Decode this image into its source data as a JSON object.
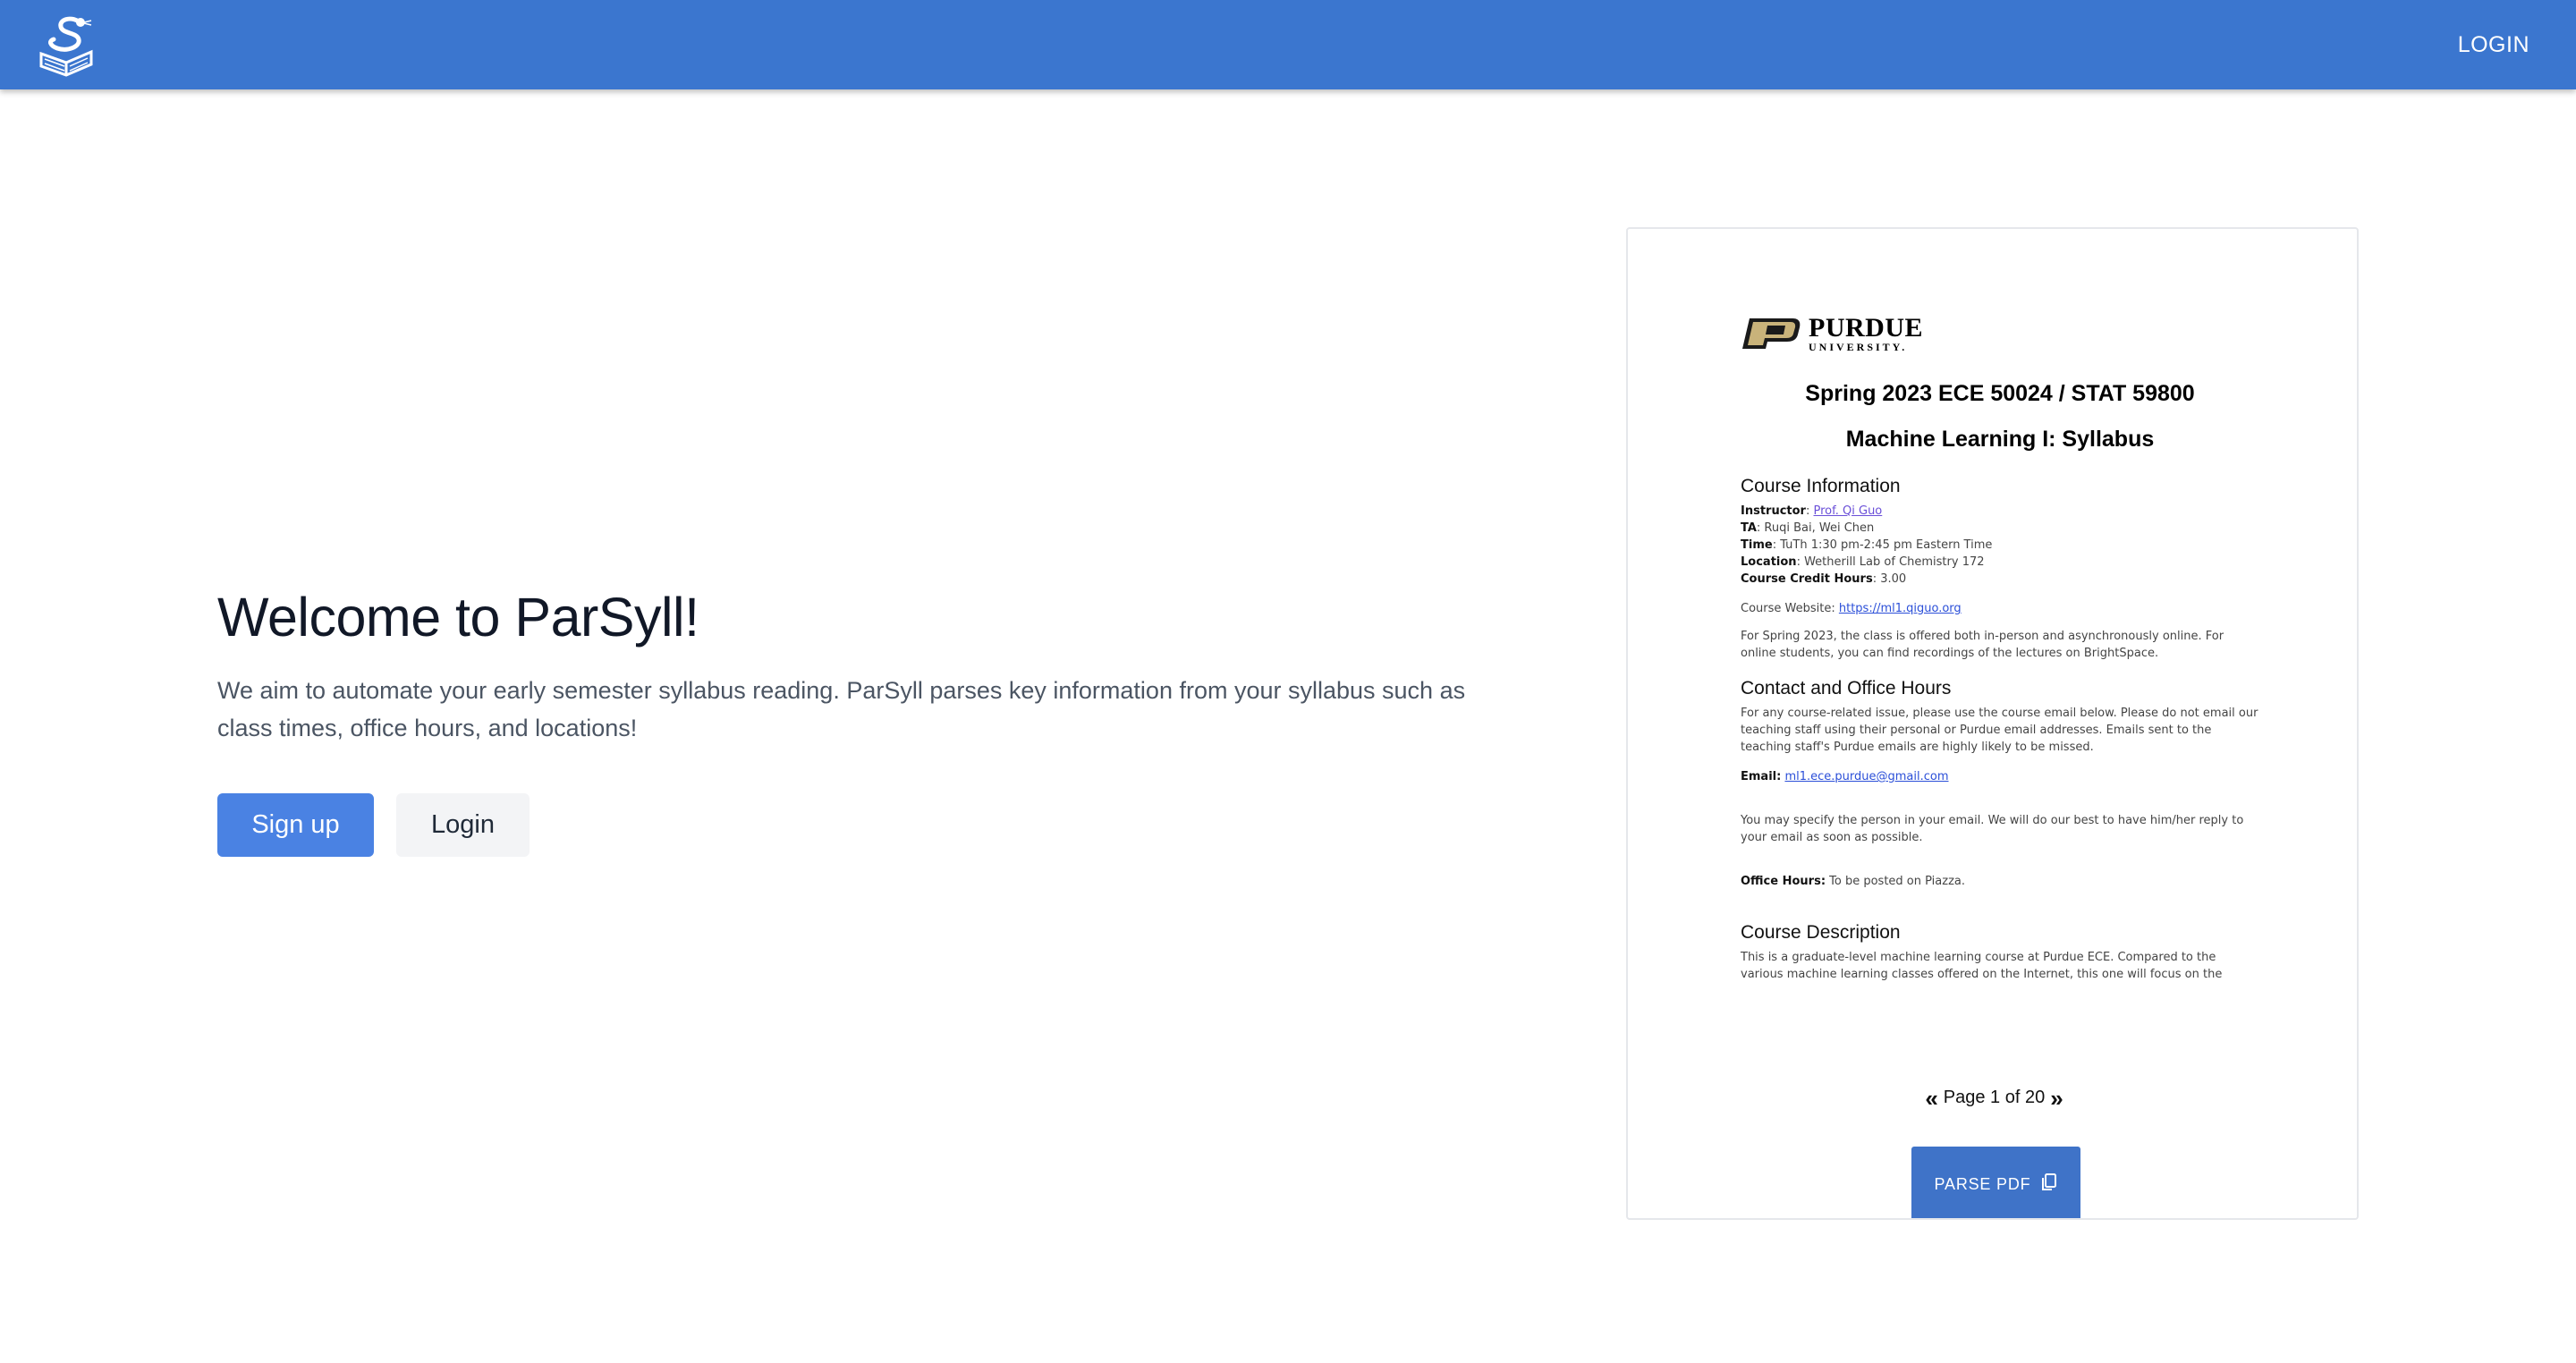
{
  "header": {
    "logo_icon": "snake-book-logo-icon",
    "login_label": "LOGIN",
    "bar_color": "#3b76cf"
  },
  "hero": {
    "title": "Welcome to ParSyll!",
    "description": "We aim to automate your early semester syllabus reading. ParSyll parses key information from your syllabus such as class times, office hours, and locations!",
    "signup_label": "Sign up",
    "login_label": "Login",
    "primary_color": "#4a82e3"
  },
  "pdf": {
    "university_name": "PURDUE",
    "university_sub": "UNIVERSITY.",
    "course_title": "Spring 2023 ECE 50024 / STAT 59800",
    "course_subtitle": "Machine Learning I: Syllabus",
    "course_info_heading": "Course Information",
    "instructor_label": "Instructor",
    "instructor_value": "Prof. Qi Guo",
    "ta_label": "TA",
    "ta_value": ": Ruqi Bai, Wei Chen",
    "time_label": "Time",
    "time_value": ": TuTh 1:30 pm-2:45 pm Eastern Time",
    "location_label": "Location",
    "location_value": ": Wetherill Lab of Chemistry 172",
    "credit_label": "Course Credit Hours",
    "credit_value": ": 3.00",
    "website_label": "Course Website: ",
    "website_value": "https://ml1.qiguo.org",
    "spring_note": "For Spring 2023, the class is offered both in-person and asynchronously online. For online students, you can find recordings of the lectures on BrightSpace.",
    "contact_heading": "Contact and Office Hours",
    "contact_note": "For any course-related issue, please use the course email below. Please do not email our teaching staff using their personal or Purdue email addresses. Emails sent to the teaching staff's Purdue emails are highly likely to be missed.",
    "email_label": "Email:",
    "email_value": "ml1.ece.purdue@gmail.com",
    "email_note": "You may specify the person in your email. We will do our best to have him/her reply to your email as soon as possible.",
    "office_hours_label": "Office Hours:",
    "office_hours_value": " To be posted on Piazza.",
    "description_heading": "Course Description",
    "description_text": "This is a graduate-level machine learning course at Purdue ECE. Compared to the various machine learning classes offered on the Internet, this one will focus on the"
  },
  "pager": {
    "prev_icon": "double-chevron-left-icon",
    "label": "Page 1 of 20",
    "next_icon": "double-chevron-right-icon"
  },
  "parse_button": {
    "label": "PARSE PDF",
    "icon": "copy-icon"
  }
}
